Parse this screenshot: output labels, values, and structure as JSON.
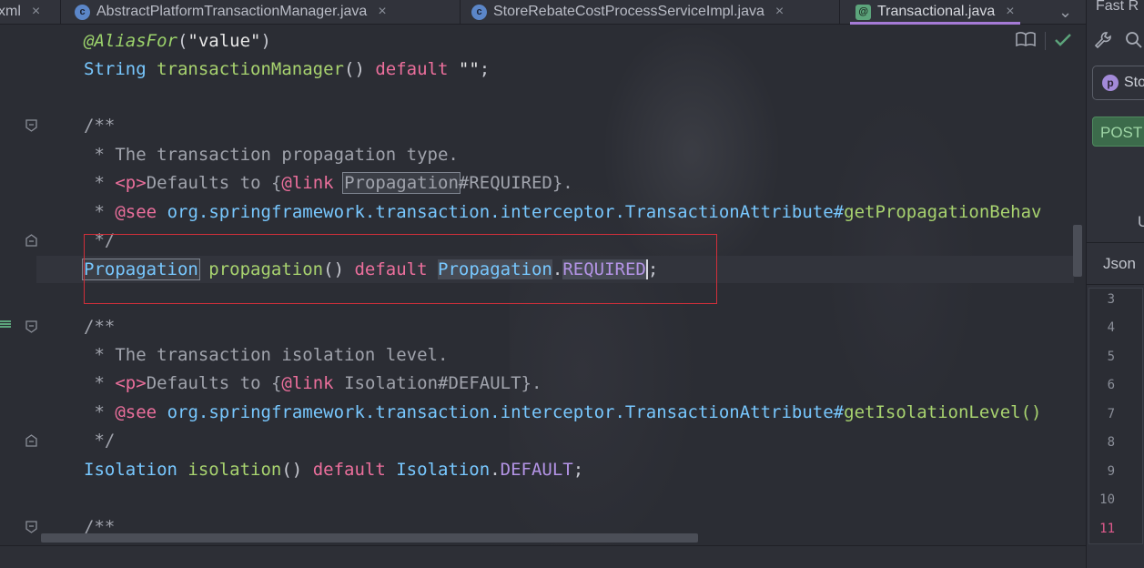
{
  "tabs": [
    {
      "label": "xml",
      "icon": "xml-file-icon",
      "active": false
    },
    {
      "label": "AbstractPlatformTransactionManager.java",
      "icon": "class-icon",
      "active": false
    },
    {
      "label": "StoreRebateCostProcessServiceImpl.java",
      "icon": "class-icon",
      "active": false
    },
    {
      "label": "Transactional.java",
      "icon": "annotation-icon",
      "active": true
    }
  ],
  "tab_close_glyph": "×",
  "tab_overflow_glyph": "⌄",
  "icon_letters": {
    "class": "c",
    "annotation": "@",
    "profile": "p"
  },
  "editor": {
    "code_lines": [
      "@AliasFor(\"value\")",
      "String transactionManager() default \"\";",
      "",
      "/**",
      " * The transaction propagation type.",
      " * <p>Defaults to {@link Propagation#REQUIRED}.",
      " * @see org.springframework.transaction.interceptor.TransactionAttribute#getPropagationBehav",
      " */",
      "Propagation propagation() default Propagation.REQUIRED;",
      "",
      "/**",
      " * The transaction isolation level.",
      " * <p>Defaults to {@link Isolation#DEFAULT}.",
      " * @see org.springframework.transaction.interceptor.TransactionAttribute#getIsolationLevel()",
      " */",
      "Isolation isolation() default Isolation.DEFAULT;",
      "",
      "/**"
    ],
    "highlight_box_color": "#d12f3a",
    "reader_mode_icon": "book-icon",
    "inspection_icon": "checkmark-icon"
  },
  "right_panel": {
    "title": "Fast R",
    "tools": [
      "wrench-icon",
      "search-icon"
    ],
    "selector_label": "Sto",
    "method_label": "POST",
    "url_fragment": "U",
    "json_tab": "Json",
    "line_numbers": [
      "3",
      "4",
      "5",
      "6",
      "7",
      "8",
      "9",
      "10",
      "11"
    ],
    "current_line": "11"
  },
  "colors": {
    "keyword": "#ec6f9c",
    "function": "#a8d36f",
    "constant": "#b494e6",
    "comment": "#a0a3ac",
    "active_tab_underline": "#a57ad6",
    "method_badge": "#3c6b4b"
  }
}
